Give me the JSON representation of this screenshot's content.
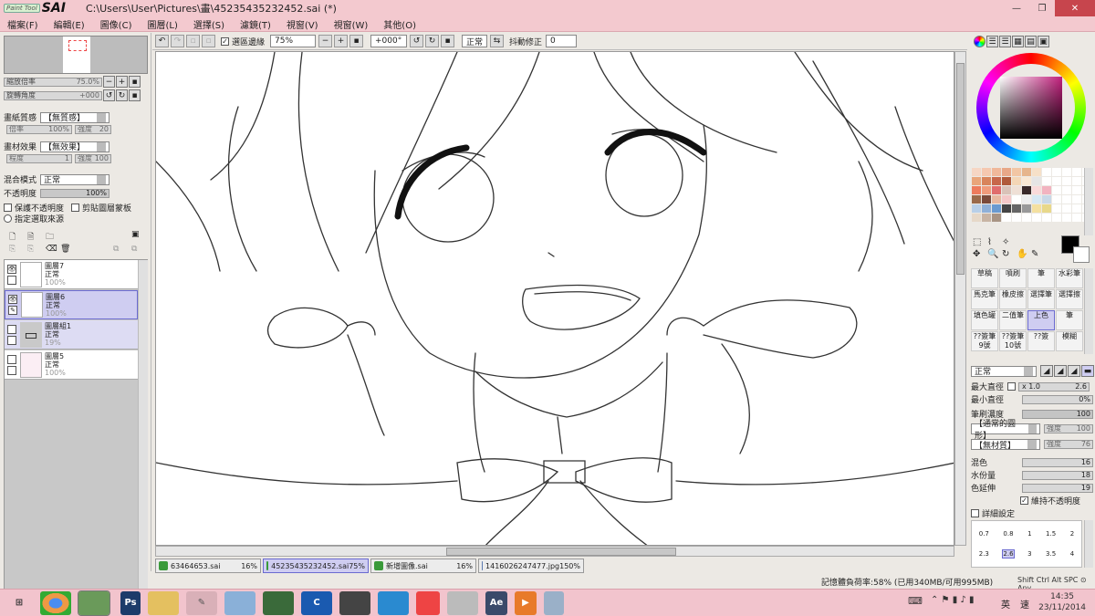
{
  "window": {
    "logo_small": "Paint Tool",
    "logo_big": "SAI",
    "title": "C:\\Users\\User\\Pictures\\畫\\45235435232452.sai (*)",
    "minimize": "—",
    "maximize": "❐",
    "close": "✕"
  },
  "menu": [
    "檔案(F)",
    "編輯(E)",
    "圖像(C)",
    "圖層(L)",
    "選擇(S)",
    "濾鏡(T)",
    "視窗(V)",
    "視窗(W)",
    "其他(O)"
  ],
  "navigator": {
    "zoom_label": "縮放倍率",
    "zoom_value": "75.0%",
    "rotate_label": "旋轉角度",
    "rotate_value": "+000"
  },
  "layer_props": {
    "paper_label": "畫紙質感",
    "paper_value": "【無質感】",
    "paper_scale_label": "倍率",
    "paper_scale": "100%",
    "paper_strength_label": "強度",
    "paper_strength": "20",
    "effect_label": "畫材效果",
    "effect_value": "【無效果】",
    "effect_degree_label": "程度",
    "effect_degree": "1",
    "effect_strength_label": "強度",
    "effect_strength": "100",
    "blend_label": "混合模式",
    "blend_value": "正常",
    "opacity_label": "不透明度",
    "opacity_value": "100%",
    "preserve_opacity": "保護不透明度",
    "clip_layer": "剪貼圖層蒙板",
    "selection_source": "指定選取來源"
  },
  "layers": [
    {
      "name": "圖層7",
      "mode": "正常",
      "opacity": "100%",
      "active": false,
      "group": false
    },
    {
      "name": "圖層6",
      "mode": "正常",
      "opacity": "100%",
      "active": true,
      "group": false
    },
    {
      "name": "圖層組1",
      "mode": "正常",
      "opacity": "19%",
      "active": false,
      "group": true
    },
    {
      "name": "圖層5",
      "mode": "正常",
      "opacity": "100%",
      "active": false,
      "group": false
    }
  ],
  "toolbar": {
    "selection_edge_label": "選區邊緣",
    "zoom": "75%",
    "rotation": "+000°",
    "mode": "正常",
    "stabilizer_label": "抖動修正",
    "stabilizer_value": "0"
  },
  "tabs": [
    {
      "name": "63464653.sai",
      "zoom": "16%",
      "active": false
    },
    {
      "name": "45235435232452.sai",
      "zoom": "75%",
      "active": true
    },
    {
      "name": "新增圖像.sai",
      "zoom": "16%",
      "active": false
    },
    {
      "name": "1416026247477.jpg",
      "zoom": "150%",
      "active": false
    }
  ],
  "status": {
    "memory": "記憶體負荷率:58% (已用340MB/可用995MB)",
    "keys": "Shift Ctrl Alt SPC ⊙ Any"
  },
  "tools": [
    "草稿",
    "噴刷",
    "筆",
    "水彩筆",
    "馬克筆",
    "橡皮擦",
    "選擇筆",
    "選擇擦",
    "填色罐",
    "二值筆",
    "上色",
    "筆",
    "??簽筆 9號",
    "??簽筆 10號",
    "??簽",
    "模糊"
  ],
  "brush": {
    "mode": "正常",
    "max_diam_label": "最大直徑",
    "max_diam_mult": "x 1.0",
    "max_diam_value": "2.6",
    "min_diam_label": "最小直徑",
    "min_diam_value": "0%",
    "density_label": "筆刷濃度",
    "density_value": "100",
    "shape": "【通常的圓形】",
    "shape_strength_label": "強度",
    "shape_strength": "100",
    "texture": "【無材質】",
    "texture_strength_label": "強度",
    "texture_strength": "76",
    "blend_label": "混色",
    "blend_value": "16",
    "water_label": "水份量",
    "water_value": "18",
    "persist_label": "色延伸",
    "persist_value": "19",
    "keep_opacity": "維持不透明度",
    "details": "詳細設定",
    "sizes_row1": [
      "0.7",
      "0.8",
      "1",
      "1.5",
      "2"
    ],
    "sizes_row2": [
      "2.3",
      "2.6",
      "3",
      "3.5",
      "4"
    ]
  },
  "swatch_colors": [
    "#f6d6c4",
    "#f5c8b0",
    "#f0b89a",
    "#e8a888",
    "#f2c6a4",
    "#e6b58c",
    "#f6e0c8",
    "#fff",
    "#fff",
    "#fff",
    "#fff",
    "#fff",
    "#e9a57a",
    "#d8845b",
    "#c7674a",
    "#b05a3a",
    "#f4d6b6",
    "#f9e8d4",
    "#e5e5e5",
    "#fff",
    "#fff",
    "#fff",
    "#fff",
    "#fff",
    "#ed7b5c",
    "#ef9b7b",
    "#e06d6d",
    "#d9c2b8",
    "#efe0d6",
    "#3a2a2a",
    "#f9dada",
    "#f2b3c0",
    "#fff",
    "#fff",
    "#fff",
    "#fff",
    "#9a6a4a",
    "#7a4a3a",
    "#e8b8a0",
    "#f4c8c8",
    "#ffffff",
    "#eeeeee",
    "#d6e8f4",
    "#c8d8e8",
    "#fff",
    "#fff",
    "#fff",
    "#fff",
    "#b8cfe8",
    "#8fb0d8",
    "#6a9ad0",
    "#444",
    "#666",
    "#999",
    "#f4e0a0",
    "#e8d88a",
    "#fff",
    "#fff",
    "#fff",
    "#fff",
    "#e6d8c8",
    "#c8b4a4",
    "#a89484",
    "#fff",
    "#fff",
    "#fff",
    "#fff",
    "#fff",
    "#fff",
    "#fff",
    "#fff",
    "#fff"
  ],
  "taskbar": {
    "time": "14:35",
    "date": "23/11/2014",
    "ime": "英",
    "ime2": "速"
  }
}
